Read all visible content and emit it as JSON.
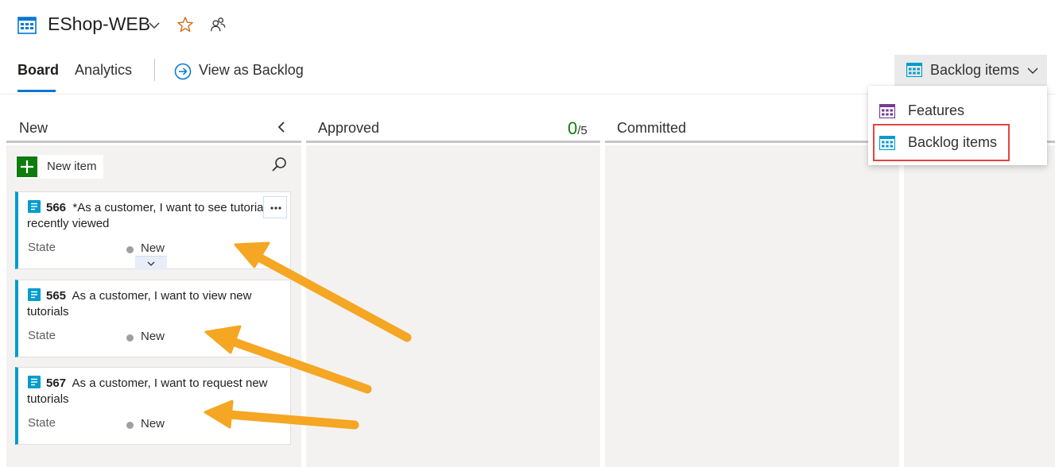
{
  "header": {
    "title": "EShop-WEB",
    "icons": [
      "team-board-icon",
      "chevron-down-icon",
      "favorite-star-icon",
      "team-members-icon"
    ]
  },
  "tabs": [
    {
      "label": "Board",
      "selected": true
    },
    {
      "label": "Analytics",
      "selected": false
    }
  ],
  "view_as_backlog": "View as Backlog",
  "backlog_level": {
    "selected": "Backlog items",
    "menu": [
      {
        "label": "Features",
        "icon": "features-icon",
        "color": "#773b93"
      },
      {
        "label": "Backlog items",
        "icon": "backlog-items-icon",
        "color": "#009ccc",
        "highlighted": true
      }
    ]
  },
  "columns": [
    {
      "title": "New",
      "wip_current": "",
      "wip_limit": ""
    },
    {
      "title": "Approved",
      "wip_current": "0",
      "wip_limit": "/5"
    },
    {
      "title": "Committed",
      "wip_current": "",
      "wip_limit": ""
    }
  ],
  "new_item_label": "New item",
  "cards": [
    {
      "id": "566",
      "title": "*As a customer, I want to see tutorials I recently viewed",
      "state_label": "State",
      "state": "New"
    },
    {
      "id": "565",
      "title": "As a customer, I want to view new tutorials",
      "state_label": "State",
      "state": "New"
    },
    {
      "id": "567",
      "title": "As a customer, I want to request new tutorials",
      "state_label": "State",
      "state": "New"
    }
  ],
  "colors": {
    "accent": "#0078d4",
    "backlog_item": "#009ccc",
    "feature": "#773b93",
    "new_item_button": "#107c10",
    "wip_count": "#107c10",
    "annotation_arrow": "#f5a623",
    "highlight_box": "#e04545"
  }
}
